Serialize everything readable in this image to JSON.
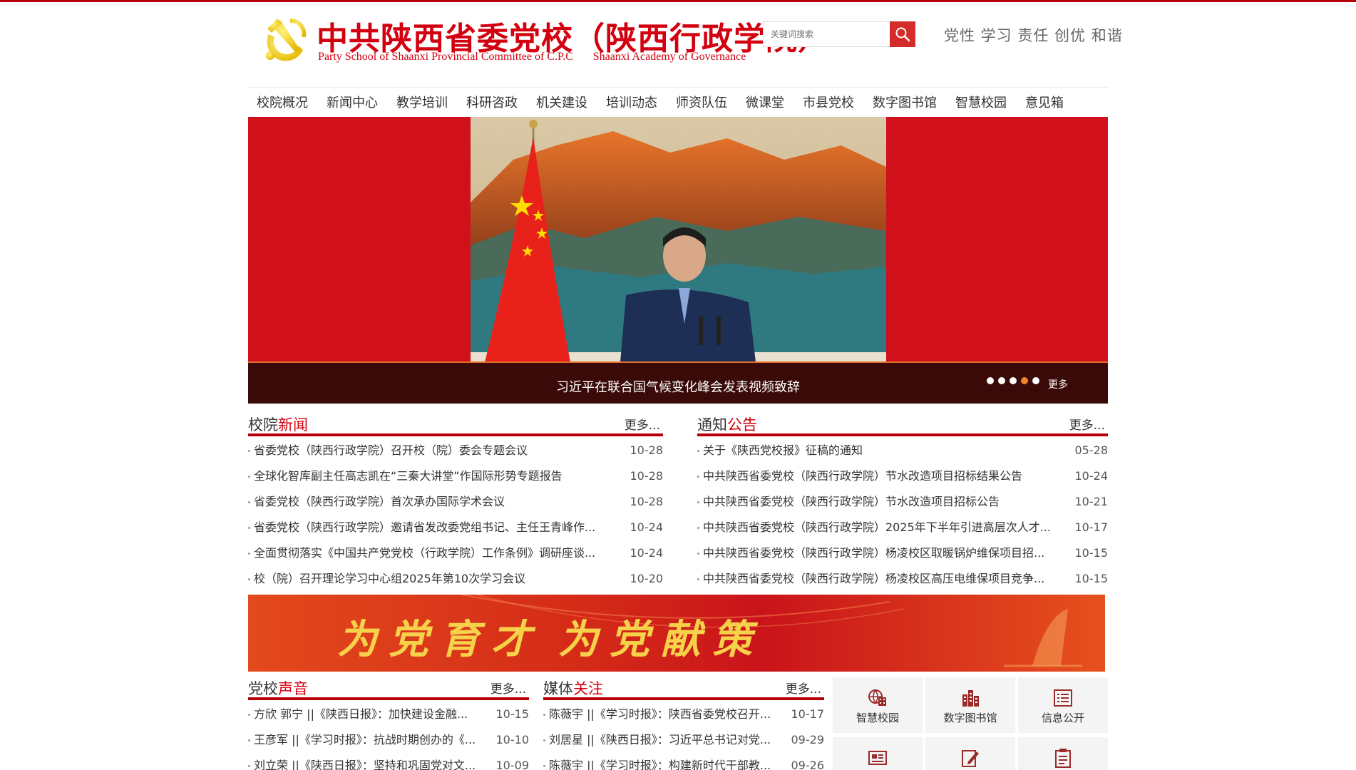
{
  "header": {
    "title_cn": "中共陕西省委党校（陕西行政学院）",
    "title_en_1": "Party School of Shaanxi Provincial Committee of C.P.C",
    "title_en_2": "Shaanxi Academy of Governance",
    "search_placeholder": "关键词搜索",
    "motto": "党性 学习 责任 创优 和谐"
  },
  "nav": [
    "校院概况",
    "新闻中心",
    "教学培训",
    "科研咨政",
    "机关建设",
    "培训动态",
    "师资队伍",
    "微课堂",
    "市县党校",
    "数字图书馆",
    "智慧校园",
    "意见箱"
  ],
  "banner": {
    "caption": "习近平在联合国气候变化峰会发表视频致辞",
    "more": "更多",
    "dot_count": 5,
    "active_dot": 4
  },
  "school_news": {
    "title_a": "校院",
    "title_b": "新闻",
    "more": "更多...",
    "items": [
      {
        "title": "省委党校（陕西行政学院）召开校（院）委会专题会议",
        "date": "10-28"
      },
      {
        "title": "全球化智库副主任高志凯在“三秦大讲堂”作国际形势专题报告",
        "date": "10-28"
      },
      {
        "title": "省委党校（陕西行政学院）首次承办国际学术会议",
        "date": "10-28"
      },
      {
        "title": "省委党校（陕西行政学院）邀请省发改委党组书记、主任王青峰作...",
        "date": "10-24"
      },
      {
        "title": "全面贯彻落实《中国共产党党校（行政学院）工作条例》调研座谈...",
        "date": "10-24"
      },
      {
        "title": "校（院）召开理论学习中心组2025年第10次学习会议",
        "date": "10-20"
      }
    ]
  },
  "notices": {
    "title_a": "通知",
    "title_b": "公告",
    "more": "更多...",
    "items": [
      {
        "title": "关于《陕西党校报》征稿的通知",
        "date": "05-28"
      },
      {
        "title": "中共陕西省委党校（陕西行政学院）节水改造项目招标结果公告",
        "date": "10-24"
      },
      {
        "title": "中共陕西省委党校（陕西行政学院）节水改造项目招标公告",
        "date": "10-21"
      },
      {
        "title": "中共陕西省委党校（陕西行政学院）2025年下半年引进高层次人才...",
        "date": "10-17"
      },
      {
        "title": "中共陕西省委党校（陕西行政学院）杨凌校区取暖锅炉维保项目招...",
        "date": "10-15"
      },
      {
        "title": "中共陕西省委党校（陕西行政学院）杨凌校区高压电维保项目竞争...",
        "date": "10-15"
      }
    ]
  },
  "slogan": {
    "part1": "为党育才",
    "part2": "为党献策"
  },
  "voice": {
    "title_a": "党校",
    "title_b": "声音",
    "more": "更多...",
    "items": [
      {
        "title": "方欣 郭宁 ||《陕西日报》：加快建设金融...",
        "date": "10-15"
      },
      {
        "title": "王彦军 ||《学习时报》：抗战时期创办的《...",
        "date": "10-10"
      },
      {
        "title": "刘立荣 ||《陕西日报》：坚持和巩固党对文...",
        "date": "10-09"
      }
    ]
  },
  "media": {
    "title_a": "媒体",
    "title_b": "关注",
    "more": "更多...",
    "items": [
      {
        "title": "陈薇宇 ||《学习时报》：陕西省委党校召开...",
        "date": "10-17"
      },
      {
        "title": "刘居星 ||《陕西日报》：习近平总书记对党...",
        "date": "09-29"
      },
      {
        "title": "陈薇宇 ||《学习时报》：构建新时代干部教...",
        "date": "09-26"
      }
    ]
  },
  "quick_links": {
    "smart_campus": "智慧校园",
    "digital_library": "数字图书馆",
    "info_disclosure": "信息公开"
  },
  "colors": {
    "brand_red": "#d3000f",
    "dark_red": "#b8000b",
    "slogan_gold": "#f6d24a",
    "dot_active": "#f1832b"
  }
}
